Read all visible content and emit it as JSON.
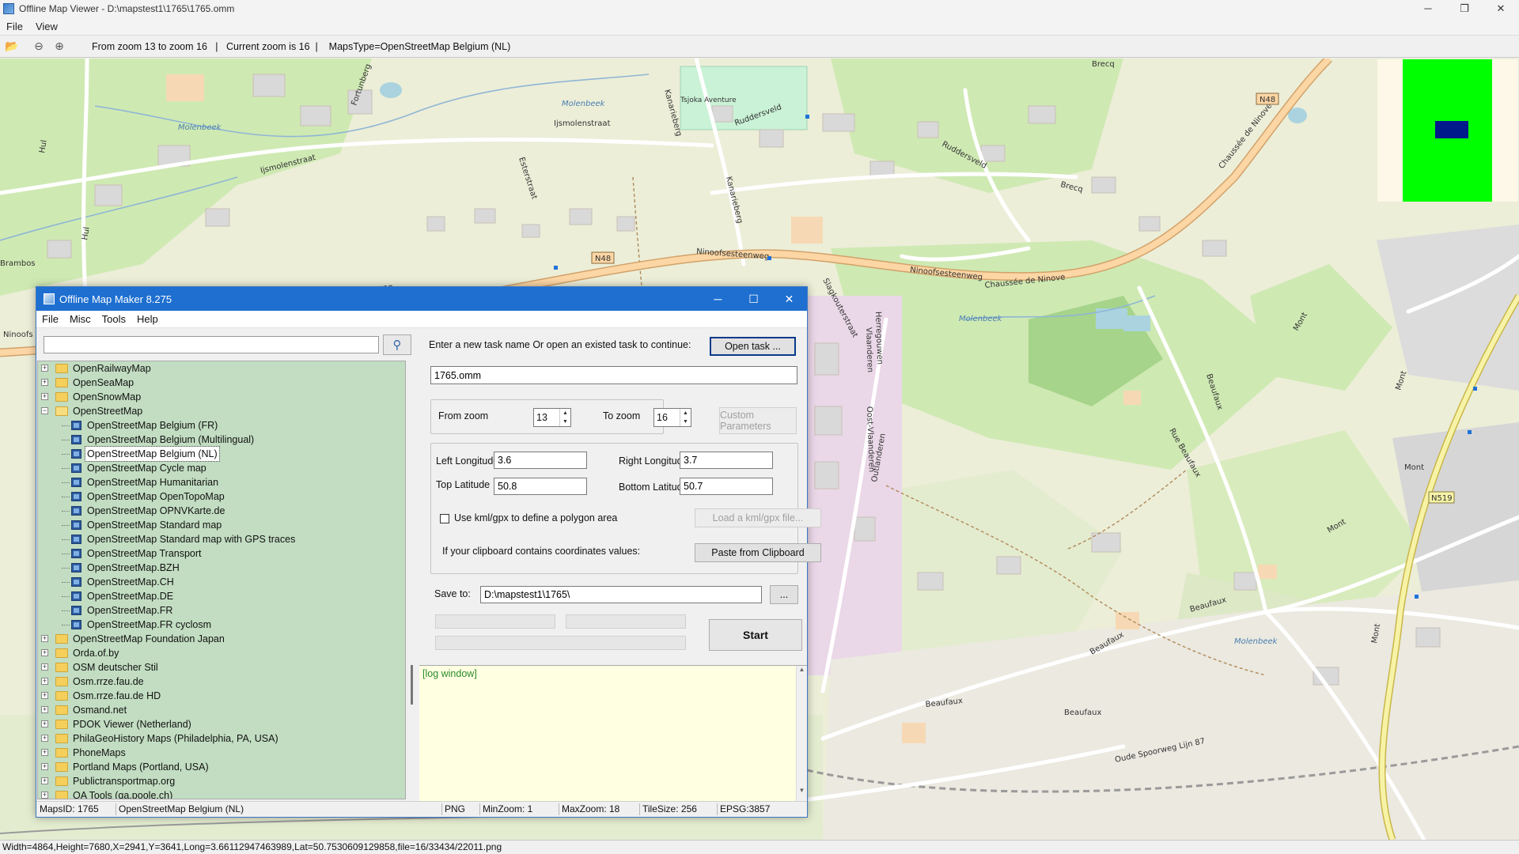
{
  "window": {
    "title": "Offline Map Viewer - D:\\mapstest1\\1765\\1765.omm",
    "controls": [
      "─",
      "❐",
      "✕"
    ]
  },
  "menu": [
    "File",
    "View"
  ],
  "toolbar": {
    "info": "From zoom 13 to zoom 16   |   Current zoom is 16  |    MapsType=OpenStreetMap Belgium (NL)"
  },
  "map": {
    "streets": [
      "Ijsmolenstraat",
      "Ijsmolenstraat",
      "Ruddersveld",
      "Ruddersveld",
      "Kanarieberg",
      "Kanarieberg",
      "Esterstraat",
      "Ninoofsesteenweg",
      "Ninoofsesteenweg",
      "Ninoofsesteenweg",
      "Chaussée de Ninove",
      "Chaussée de Ninove",
      "Brecq",
      "Brecq",
      "Slagkouterstraat",
      "Vlaanderen",
      "Herregouwen",
      "Oost-Vlaanderen",
      "Outlanderen",
      "Beaufaux",
      "Beaufaux",
      "Beaufaux",
      "Beaufaux",
      "Beaufaux",
      "Rue Beaufaux",
      "Mont",
      "Mont",
      "Mont",
      "Mont",
      "Mont",
      "Oude Spoorweg Lijn 87",
      "Fortunberg",
      "Brambos",
      "Hul",
      "Hul",
      "Ninoofs"
    ],
    "water": [
      "Molenbeek",
      "Molenbeek",
      "Molenbeek",
      "Molenbeek"
    ],
    "shields": [
      "N48",
      "N48",
      "N519"
    ],
    "park": "Tsjoka Aventure"
  },
  "dialog": {
    "title": "Offline Map Maker 8.275",
    "menu": [
      "File",
      "Misc",
      "Tools",
      "Help"
    ],
    "search": {
      "value": "",
      "placeholder": ""
    },
    "tree": [
      {
        "label": "OpenRailwayMap",
        "level": 0,
        "expanded": false
      },
      {
        "label": "OpenSeaMap",
        "level": 0,
        "expanded": false
      },
      {
        "label": "OpenSnowMap",
        "level": 0,
        "expanded": false
      },
      {
        "label": "OpenStreetMap",
        "level": 0,
        "expanded": true
      },
      {
        "label": "OpenStreetMap Belgium (FR)",
        "level": 1
      },
      {
        "label": "OpenStreetMap Belgium (Multilingual)",
        "level": 1
      },
      {
        "label": "OpenStreetMap Belgium (NL)",
        "level": 1,
        "selected": true
      },
      {
        "label": "OpenStreetMap Cycle map",
        "level": 1
      },
      {
        "label": "OpenStreetMap Humanitarian",
        "level": 1
      },
      {
        "label": "OpenStreetMap OpenTopoMap",
        "level": 1
      },
      {
        "label": "OpenStreetMap OPNVKarte.de",
        "level": 1
      },
      {
        "label": "OpenStreetMap Standard map",
        "level": 1
      },
      {
        "label": "OpenStreetMap Standard map with GPS traces",
        "level": 1
      },
      {
        "label": "OpenStreetMap Transport",
        "level": 1
      },
      {
        "label": "OpenStreetMap.BZH",
        "level": 1
      },
      {
        "label": "OpenStreetMap.CH",
        "level": 1
      },
      {
        "label": "OpenStreetMap.DE",
        "level": 1
      },
      {
        "label": "OpenStreetMap.FR",
        "level": 1
      },
      {
        "label": "OpenStreetMap.FR cyclosm",
        "level": 1
      },
      {
        "label": "OpenStreetMap Foundation Japan",
        "level": 0,
        "expanded": false
      },
      {
        "label": "Orda.of.by",
        "level": 0,
        "expanded": false
      },
      {
        "label": "OSM deutscher Stil",
        "level": 0,
        "expanded": false
      },
      {
        "label": "Osm.rrze.fau.de",
        "level": 0,
        "expanded": false
      },
      {
        "label": "Osm.rrze.fau.de HD",
        "level": 0,
        "expanded": false
      },
      {
        "label": "Osmand.net",
        "level": 0,
        "expanded": false
      },
      {
        "label": "PDOK Viewer (Netherland)",
        "level": 0,
        "expanded": false
      },
      {
        "label": "PhilaGeoHistory Maps (Philadelphia, PA, USA)",
        "level": 0,
        "expanded": false
      },
      {
        "label": "PhoneMaps",
        "level": 0,
        "expanded": false
      },
      {
        "label": "Portland Maps (Portland, USA)",
        "level": 0,
        "expanded": false
      },
      {
        "label": "Publictransportmap.org",
        "level": 0,
        "expanded": false
      },
      {
        "label": "QA Tools (qa.poole.ch)",
        "level": 0,
        "expanded": false
      }
    ],
    "task_prompt": "Enter a new task name Or open an existed task to continue:",
    "open_task_button": "Open task ...",
    "task_name": "1765.omm",
    "from_zoom_label": "From zoom",
    "from_zoom_value": "13",
    "to_zoom_label": "To zoom",
    "to_zoom_value": "16",
    "custom_params_button": "Custom Parameters",
    "left_longitude_label": "Left Longitude",
    "left_longitude": "3.6",
    "right_longitude_label": "Right Longitude",
    "right_longitude": "3.7",
    "top_latitude_label": "Top Latitude",
    "top_latitude": "50.8",
    "bottom_latitude_label": "Bottom Latitude",
    "bottom_latitude": "50.7",
    "kml_checkbox_label": "Use kml/gpx to define a polygon area",
    "kml_checked": false,
    "load_kml_button": "Load a kml/gpx file...",
    "clipboard_label": "If your clipboard contains coordinates values:",
    "paste_button": "Paste from Clipboard",
    "save_to_label": "Save to:",
    "save_to_value": "D:\\mapstest1\\1765\\",
    "browse_button": "...",
    "start_button": "Start",
    "log_text": "[log window]",
    "status": {
      "maps_id": "MapsID: 1765",
      "map_name": "OpenStreetMap Belgium (NL)",
      "format": "PNG",
      "min_zoom": "MinZoom: 1",
      "max_zoom": "MaxZoom: 18",
      "tile_size": "TileSize: 256",
      "epsg": "EPSG:3857"
    }
  },
  "status_bar": "Width=4864,Height=7680,X=2941,Y=3641,Long=3.66112947463989,Lat=50.7530609129858,file=16/33434/22011.png",
  "colors": {
    "dialog_title_bar": "#1e6fd0",
    "tree_background": "#c2ddc2",
    "log_background": "#ffffe1",
    "minimap_extent": "#00ff00",
    "minimap_view": "#001a8c"
  }
}
